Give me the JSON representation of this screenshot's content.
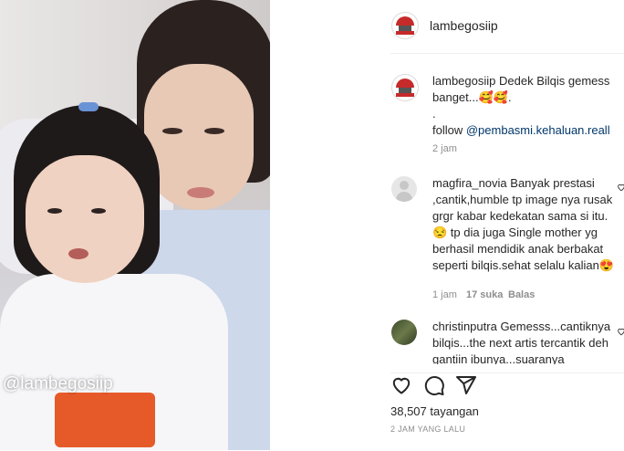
{
  "post": {
    "author": "lambegosiip",
    "media_watermark": "@lambegosiip",
    "caption": {
      "username": "lambegosiip",
      "text": "Dedek Bilqis gemess banget...",
      "emojis": "🥰🥰",
      "after_emoji": ".",
      "dot_line": ".",
      "follow_prefix": "follow ",
      "follow_mention": "@pembasmi.kehaluan.reall",
      "time": "2 jam"
    },
    "comments": [
      {
        "username": "magfira_novia",
        "text_1": "Banyak prestasi ,cantik,humble tp image nya rusak grgr kabar kedekatan sama si itu.",
        "emoji_1": "😒",
        "text_2": " tp dia juga Single mother yg berhasil mendidik anak berbakat seperti bilqis.sehat selalu kalian",
        "emoji_2": "😍",
        "time": "1 jam",
        "likes": "17 suka",
        "reply": "Balas"
      },
      {
        "username": "christinputra",
        "text": "Gemesss...cantiknya bilqis...the next artis tercantik deh gantiin ibunya...suaranya"
      }
    ],
    "views": "38,507 tayangan",
    "posted": "2 JAM YANG LALU"
  },
  "icons": {
    "like": "heart-icon",
    "comment": "comment-icon",
    "share": "share-icon"
  },
  "colors": {
    "mention": "#00376b",
    "meta": "#8e8e8e",
    "text": "#262626"
  }
}
